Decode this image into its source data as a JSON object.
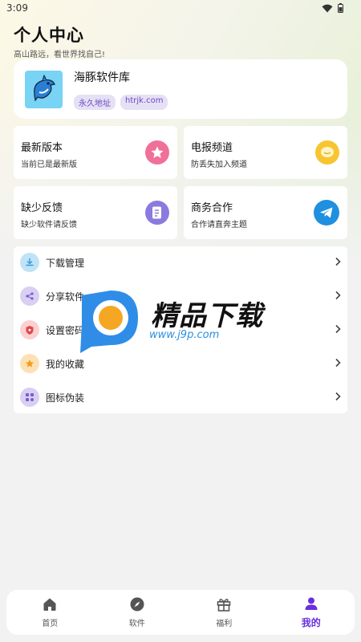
{
  "status_bar": {
    "time": "3:09"
  },
  "header": {
    "title": "个人中心",
    "subtitle": "高山路远，看世界找自己!"
  },
  "profile": {
    "name": "海豚软件库",
    "tags": [
      "永久地址",
      "htrjk.com"
    ]
  },
  "cards": [
    {
      "title": "最新版本",
      "subtitle": "当前已是最新版",
      "icon": "star-icon",
      "color": "#f0709a"
    },
    {
      "title": "电报频道",
      "subtitle": "防丢失加入频道",
      "icon": "chat-bubble-icon",
      "color": "#f7c530"
    },
    {
      "title": "缺少反馈",
      "subtitle": "缺少软件请反馈",
      "icon": "feedback-doc-icon",
      "color": "#8a7ae0"
    },
    {
      "title": "商务合作",
      "subtitle": "合作请直奔主题",
      "icon": "telegram-icon",
      "color": "#1f8fe0"
    }
  ],
  "menu": [
    {
      "label": "下载管理",
      "icon": "download-icon",
      "color": "#bfe3f7"
    },
    {
      "label": "分享软件",
      "icon": "share-icon",
      "color": "#d9cff3"
    },
    {
      "label": "设置密码",
      "icon": "shield-icon",
      "color": "#fbd0d0"
    },
    {
      "label": "我的收藏",
      "icon": "star-icon",
      "color": "#fde1b5"
    },
    {
      "label": "图标伪装",
      "icon": "apps-icon",
      "color": "#d9cff3"
    }
  ],
  "watermark": {
    "brand": "精品下载",
    "url": "www.j9p.com"
  },
  "tabs": [
    {
      "label": "首页",
      "icon": "home-icon",
      "active": false
    },
    {
      "label": "软件",
      "icon": "compass-icon",
      "active": false
    },
    {
      "label": "福利",
      "icon": "gift-icon",
      "active": false
    },
    {
      "label": "我的",
      "icon": "user-icon",
      "active": true
    }
  ],
  "colors": {
    "accent": "#6a2ee0",
    "tag_text": "#6a4bc4",
    "tag_bg": "#e6e0f5"
  }
}
